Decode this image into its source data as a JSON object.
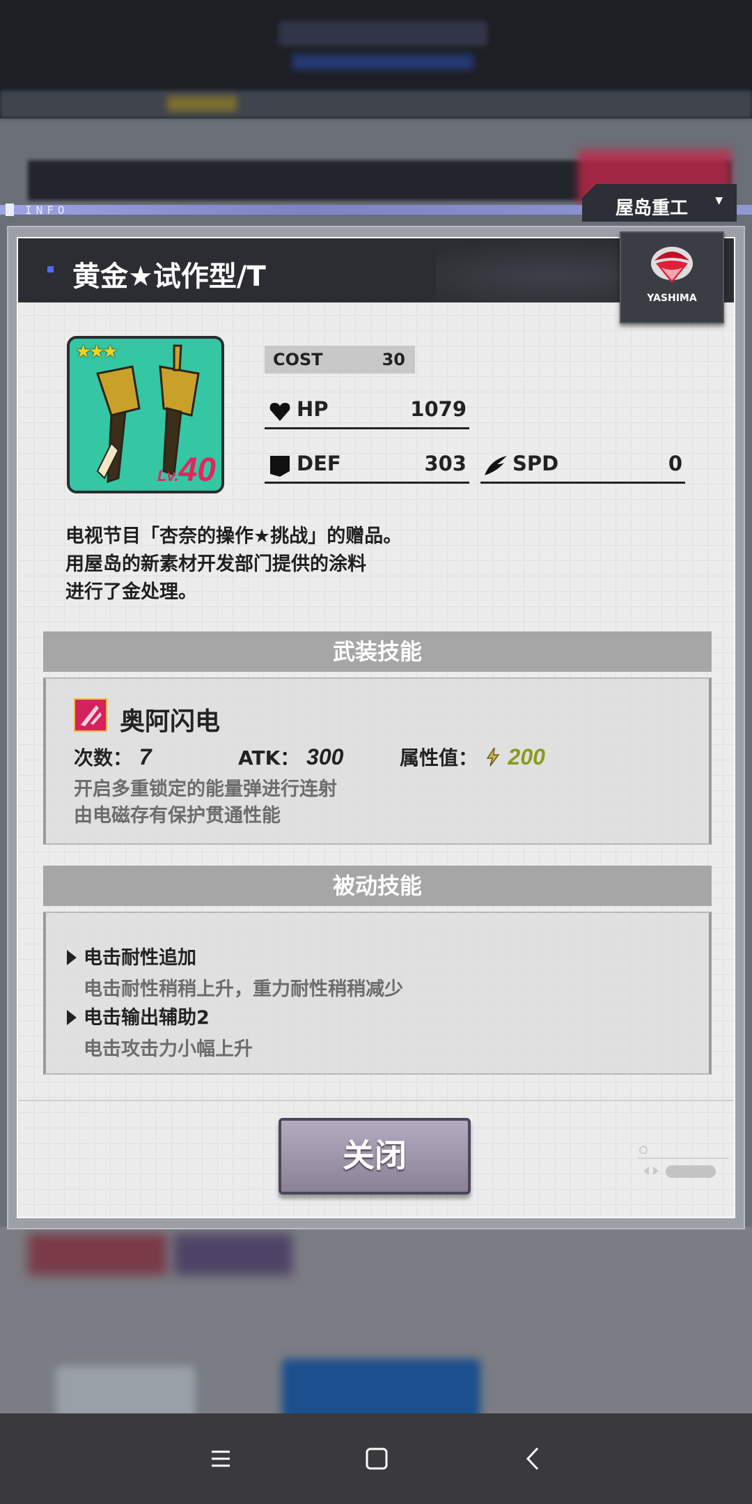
{
  "header": {
    "info_label": "INFO",
    "manufacturer": "屋岛重工",
    "manufacturer_caret": "▼"
  },
  "part": {
    "name": "黄金★试作型/T",
    "brand": "YASHIMA",
    "stars": "★★★",
    "level_prefix": "Lv.",
    "level": "40",
    "cost_label": "COST",
    "cost": "30",
    "hp_label": "HP",
    "hp": "1079",
    "def_label": "DEF",
    "def": "303",
    "spd_label": "SPD",
    "spd": "0",
    "description": [
      "电视节目「杏奈的操作★挑战」的赠品。",
      "用屋岛的新素材开发部门提供的涂料",
      "进行了金处理。"
    ]
  },
  "weapon_skill": {
    "header": "武装技能",
    "name": "奥阿闪电",
    "count_label": "次数：",
    "count": "7",
    "atk_label": "ATK：",
    "atk": "300",
    "attr_label": "属性值：",
    "attr": "200",
    "description": [
      "开启多重锁定的能量弹进行连射",
      "由电磁存有保护贯通性能"
    ]
  },
  "passive_skill": {
    "header": "被动技能",
    "items": [
      {
        "name": "电击耐性追加",
        "desc": "电击耐性稍稍上升，重力耐性稍稍减少"
      },
      {
        "name": "电击输出辅助2",
        "desc": "电击攻击力小幅上升"
      }
    ]
  },
  "footer": {
    "close_label": "关闭"
  },
  "colors": {
    "attr_green": "#8a9a1e",
    "close_purple": "#9c93a9",
    "level_pink": "#e2265d"
  }
}
